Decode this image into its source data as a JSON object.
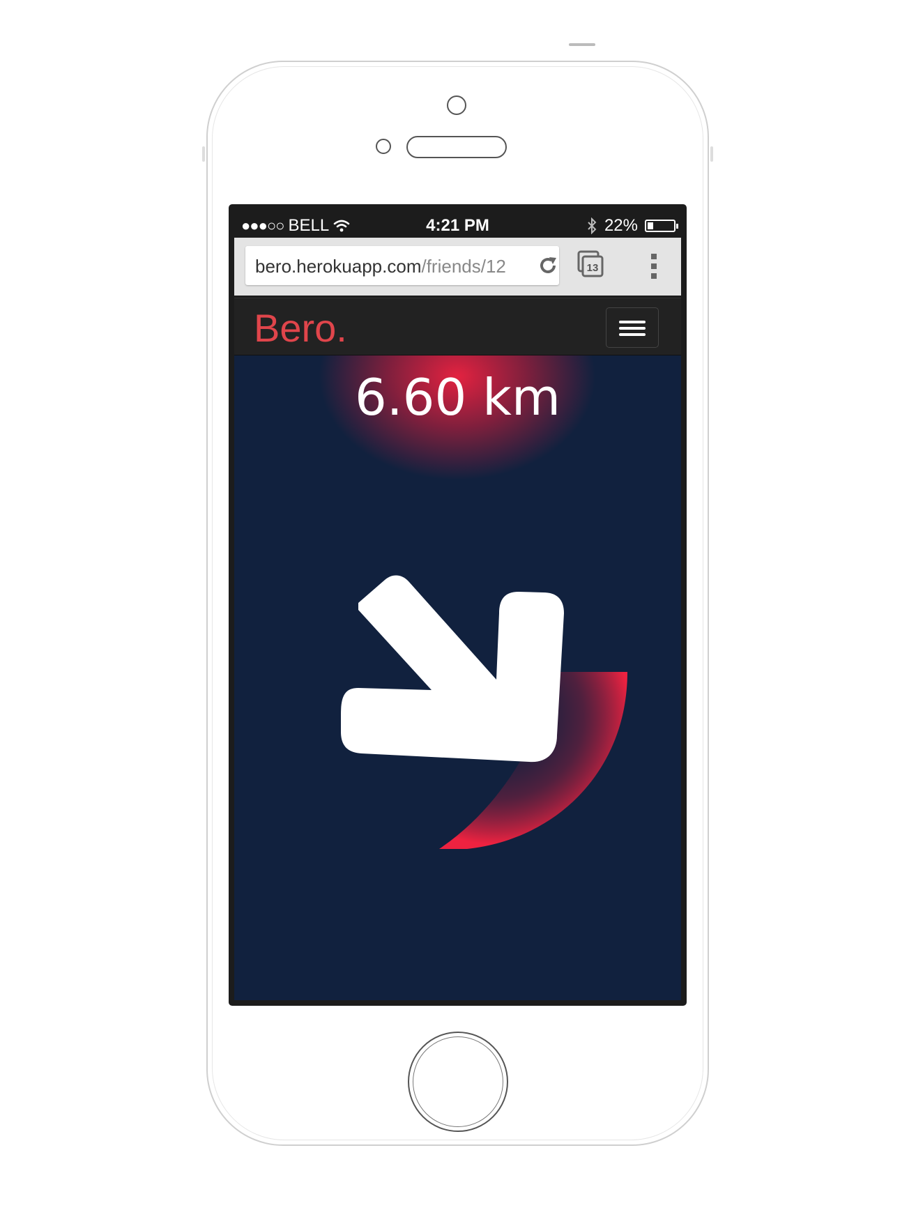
{
  "status_bar": {
    "signal": "●●●○○",
    "carrier": "BELL",
    "time": "4:21 PM",
    "battery_percent": "22%",
    "battery_level": 0.22
  },
  "browser": {
    "url_host": "bero.herokuapp.com",
    "url_path": "/friends/12",
    "tab_count": "13"
  },
  "navbar": {
    "brand": "Bero."
  },
  "main": {
    "distance": "6.60 km",
    "arrow_direction": "south-east"
  },
  "colors": {
    "brand": "#e0454b",
    "background": "#11213e",
    "glow": "#ee2240"
  }
}
